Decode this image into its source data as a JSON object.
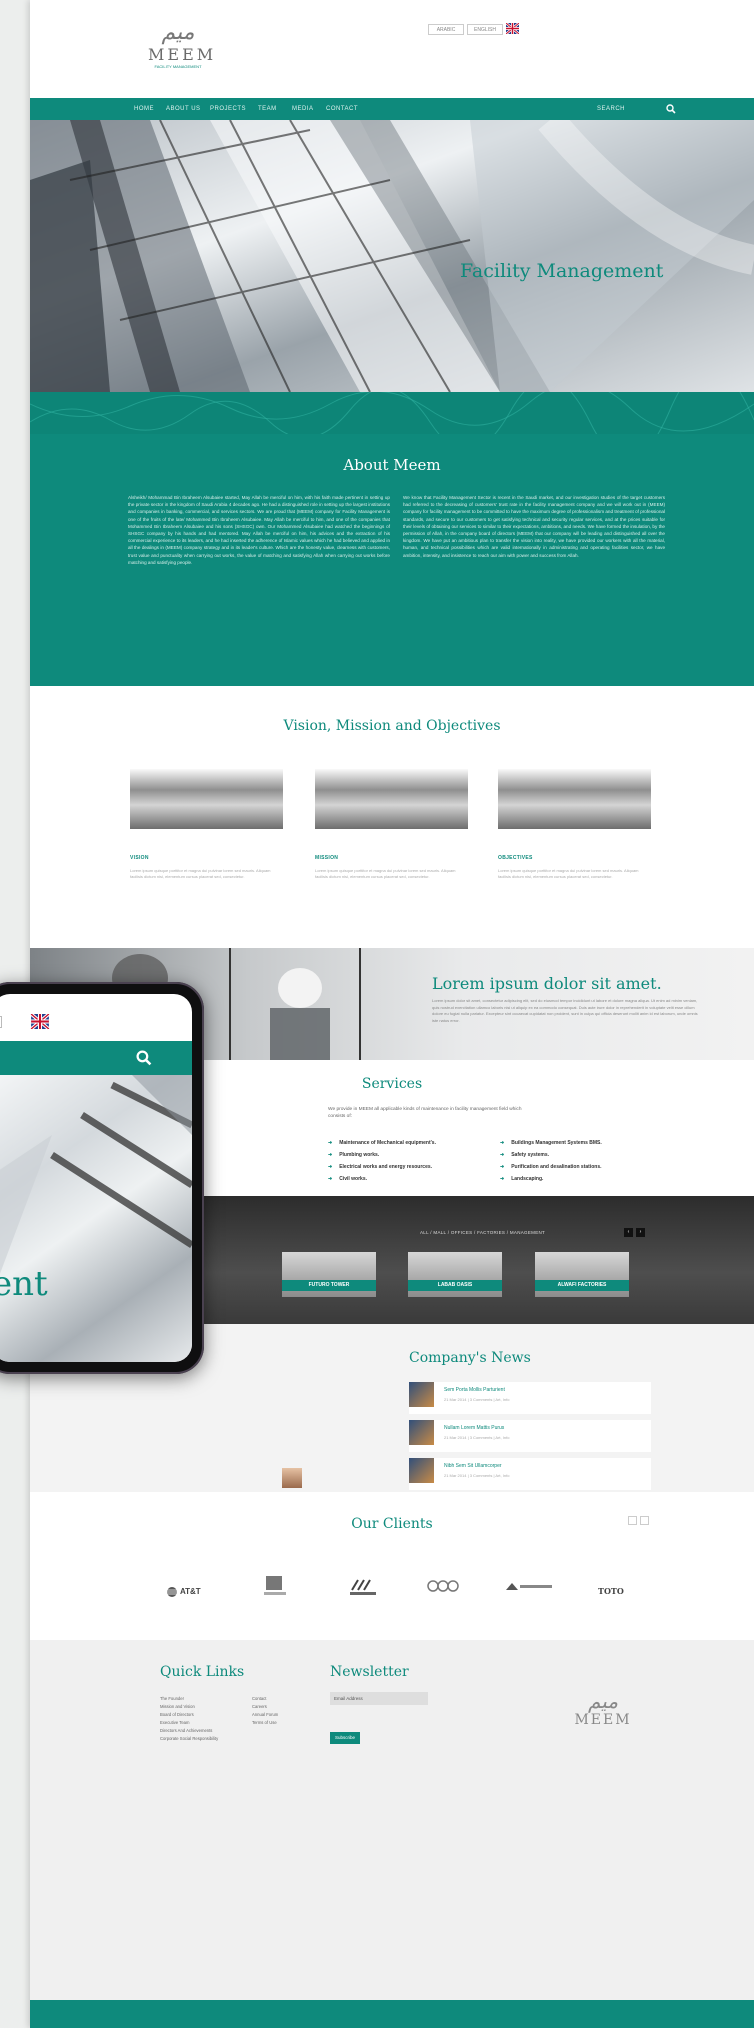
{
  "header": {
    "logo_arabic": "ميم",
    "logo_text": "MEEM",
    "logo_sub": "FACILITY MANAGEMENT",
    "lang_box_1": "ARABIC",
    "lang_box_2": "ENGLISH"
  },
  "nav": {
    "items": [
      "HOME",
      "ABOUT US",
      "PROJECTS",
      "TEAM",
      "MEDIA",
      "CONTACT"
    ],
    "search_label": "SEARCH"
  },
  "hero": {
    "title": "Facility Management"
  },
  "about": {
    "title": "About Meem",
    "col1": "Alsheikh/ Mohammad Bin Ibraheem Alsubaiee started, May Allah be merciful on him, with his faith made pertinent in setting up the private sector in the kingdom of Saudi Arabia 4 decades ago. He had a distinguished role in setting up the largest institutions and companies in banking, commercial, and services sectors. We are proud that (MEEM) company for Facility Management is one of the fruits of the late/ Mohammed Bin Ibraheem Alsubaiee. May Allah be merciful to him, and one of the companies that Mohammed Bin Ibraheem Alsubaiee and his sons (SHSGC) own. Our Mohammed Alsubaiee had watched the beginnings of SHSGC company by his hands and had mentored. May Allah be merciful on him, his advices and the extraction of his commercial experience to its leaders, and he had inserted the adherence of Islamic values which he had believed and applied in all the dealings in (MEEM) company strategy and in its leader's culture. Which are the honesty value, clearness with customers, trust value and punctuality when carrying out works, the value of matching and satisfying Allah when carrying out works before matching and satisfying people.",
    "col2": "We know that Facility Management Sector is recent in the Saudi market, and our investigation studies of the target customers had referred to the decreasing of customers' trust rate in the facility management company and we will work out in (MEEM) company for facility management to be committed to have the maximum degree of professionalism and treatment of professional standards, and secure to our customers to get satisfying technical and security regular services, and at the prices suitable for their levels of obtaining our services to similar to their expectations, ambitions, and needs. We have formed the insulation, by the permission of Allah, in the company board of directors (MEEM) that our company will be leading and distinguished all over the kingdom. We have put an ambitious plan to transfer the vision into reality, we have provided our workers with all the material, human, and technical possibilities which are valid internationally in administrating and operating facilities sector, we have ambition, intensity, and insistence to reach our aim with power and success from Allah."
  },
  "vision": {
    "title": "Vision, Mission and Objectives",
    "cards": [
      {
        "label": "VISION",
        "text": "Lorem ipsum quisque porttitor et magna dui pulvinar lorem sed mauris. Aliquam facilisis dictum nisi, elementum cursus placerat sed, consectetur."
      },
      {
        "label": "MISSION",
        "text": "Lorem ipsum quisque porttitor et magna dui pulvinar lorem sed mauris. Aliquam facilisis dictum nisi, elementum cursus placerat sed, consectetur."
      },
      {
        "label": "OBJECTIVES",
        "text": "Lorem ipsum quisque porttitor et magna dui pulvinar lorem sed mauris. Aliquam facilisis dictum nisi, elementum cursus placerat sed, consectetur."
      }
    ]
  },
  "lorem": {
    "title": "Lorem ipsum dolor sit amet.",
    "text": "Lorem ipsum dolor sit amet, consectetur adipiscing elit, sed do eiusmod tempor incididunt ut labore et dolore magna aliqua. Ut enim ad minim veniam, quis nostrud exercitation ullamco laboris nisi ut aliquip ex ea commodo consequat. Duis aute irure dolor in reprehenderit in voluptate velit esse cillum dolore eu fugiat nulla pariatur. Excepteur sint occaecat cupidatat non proident, sunt in culpa qui officia deserunt mollit anim id est laborum, unde omnis iste natus error."
  },
  "services": {
    "title": "Services",
    "intro": "We provide in MEEM all applicable kinds of maintenance in facility management field which consists of:",
    "left": [
      "Maintenance of Mechanical equipment's.",
      "Plumbing works.",
      "Electrical works and energy resources.",
      "Civil works."
    ],
    "right": [
      "Buildings Management Systems BMS.",
      "Safety systems.",
      "Purification and desalination stations.",
      "Landscaping."
    ]
  },
  "projects": {
    "filter": "ALL / MALL / OFFICES / FACTORIES / MANAGEMENT",
    "prev": "‹",
    "next": "›",
    "cards": [
      "FUTURO TOWER",
      "LABAB OASIS",
      "ALWAFI FACTORIES"
    ]
  },
  "news": {
    "title": "Company's News",
    "items": [
      {
        "title": "Sem Porta Mollis Parturient",
        "meta": "21 Mar 2014   |   3 Comments   |   Art, Info"
      },
      {
        "title": "Nullam Lorem Mattis Purus",
        "meta": "21 Mar 2014   |   3 Comments   |   Art, Info"
      },
      {
        "title": "Nibh Sem Sit Ullamcorper",
        "meta": "21 Mar 2014   |   3 Comments   |   Art, Info"
      }
    ]
  },
  "clients": {
    "title": "Our Clients",
    "logos": [
      "AT&T",
      "TOTO"
    ]
  },
  "footer": {
    "quick_links_title": "Quick Links",
    "links_col1": [
      "The Founder",
      "Mission and Vision",
      "Board of Directors",
      "Executive Team",
      "Directors And Achievements",
      "Corporate Social Responsibility"
    ],
    "links_col2": [
      "Contact",
      "Careers",
      "Annual Forum",
      "Terms of Use"
    ],
    "newsletter_title": "Newsletter",
    "email_placeholder": "Email Address",
    "subscribe_label": "Subscribe",
    "logo_arabic": "ميم",
    "logo_text": "MEEM"
  },
  "phone": {
    "hero_text": "ent"
  },
  "colors": {
    "accent": "#0e8a7c",
    "footer_bar": "#0e8a7c"
  }
}
